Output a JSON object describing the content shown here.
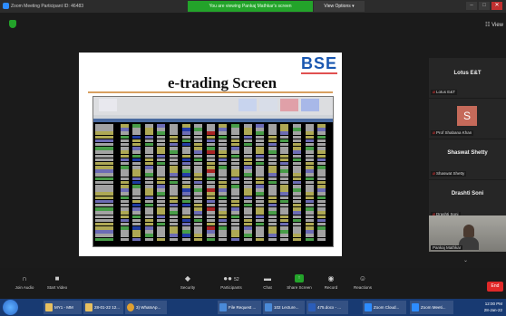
{
  "window": {
    "title": "Zoom Meeting Participant ID: 46483",
    "viewing_banner": "You are viewing Pankaj Mathkar's screen",
    "view_options": "View Options",
    "view_button": "View",
    "win_min": "–",
    "win_max": "□",
    "win_close": "✕"
  },
  "slide": {
    "title": "e-trading Screen",
    "logo_text": "BSE"
  },
  "participants": [
    {
      "name": "Lotus E&T",
      "label": "Lotus E&T"
    },
    {
      "name": "",
      "initial": "S",
      "label": "Prof Shabana Khan"
    },
    {
      "name": "Shaswat Shetty",
      "label": "Shaswat Shetty"
    },
    {
      "name": "Drashti Soni",
      "label": "Drashti Soni"
    },
    {
      "name": "",
      "label": "Pankaj Mathkar"
    }
  ],
  "toolbar": {
    "join_audio": "Join Audio",
    "start_video": "Start Video",
    "security": "Security",
    "participants": "Participants",
    "participants_count": "52",
    "chat": "Chat",
    "share_screen": "Share Screen",
    "record": "Record",
    "reactions": "Reactions",
    "end": "End"
  },
  "taskbar": {
    "items": [
      "MY1 - MM",
      "28-01-22 12...",
      "3) WhatsAp...",
      "File Request ...",
      "102 Lecture...",
      "475.docx - ...",
      "Zoom Cloud...",
      "Zoom Meeti..."
    ],
    "time": "12:00 PM",
    "date": "28-Jan-22"
  },
  "colors": {
    "green": "#23a32a",
    "end_red": "#e02828",
    "taskbar": "#183a72",
    "bse_blue": "#1a57b0"
  }
}
